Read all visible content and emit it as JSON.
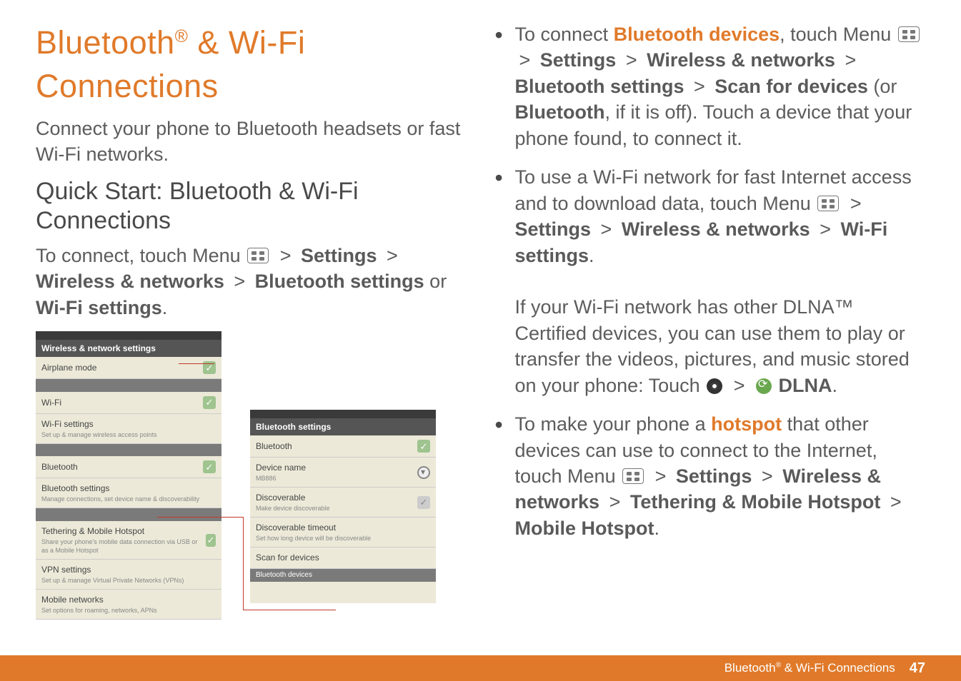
{
  "title_a": "Bluetooth",
  "title_b": " & Wi-Fi Connections",
  "intro": "Connect your phone to Bluetooth headsets or fast Wi-Fi networks.",
  "subtitle": "Quick Start: Bluetooth & Wi-Fi Connections",
  "left_line1_a": "To connect, touch Menu ",
  "left_line1_b": " > ",
  "left_settings": "Settings",
  "left_line2_a": "Wireless & networks",
  "left_line2_b": " > ",
  "left_line2_c": "Bluetooth settings",
  "left_or": " or ",
  "left_wifi": "Wi-Fi settings",
  "left_dot": ".",
  "mock1": {
    "title": "Wireless & network settings",
    "items": [
      {
        "n": "Airplane mode",
        "d": "",
        "chk": true,
        "topbox": true
      },
      {
        "n": "Wi-Fi",
        "d": "",
        "chk": true
      },
      {
        "n": "Wi-Fi settings",
        "d": "Set up & manage wireless access points",
        "arrow": false
      },
      {
        "n": "Bluetooth",
        "d": "",
        "chk": true
      },
      {
        "n": "Bluetooth settings",
        "d": "Manage connections, set device name & discoverability",
        "arrow": false
      },
      {
        "n": "Tethering & Mobile Hotspot",
        "d": "Share your phone's mobile data connection via USB or as a Mobile Hotspot",
        "chk": true
      },
      {
        "n": "VPN settings",
        "d": "Set up & manage Virtual Private Networks (VPNs)"
      },
      {
        "n": "Mobile networks",
        "d": "Set options for roaming, networks, APNs"
      }
    ]
  },
  "mock2": {
    "title": "Bluetooth settings",
    "items": [
      {
        "n": "Bluetooth",
        "d": "",
        "chk": true
      },
      {
        "n": "Device name",
        "d": "MB886",
        "radio": true
      },
      {
        "n": "Discoverable",
        "d": "Make device discoverable",
        "chkgrey": true
      },
      {
        "n": "Discoverable timeout",
        "d": "Set how long device will be discoverable"
      },
      {
        "n": "Scan for devices",
        "d": ""
      }
    ],
    "sub": "Bluetooth devices"
  },
  "r1_a": "To connect ",
  "r1_b": "Bluetooth devices",
  "r1_c": ", touch Menu ",
  "r2_gt1": " > ",
  "r2_settings": "Settings",
  "r2_gt2": " > ",
  "r2_wnlabel": "Wireless & networks",
  "r2_gt3": " > ",
  "r2_bt": "Bluetooth settings",
  "r2_gt4": " > ",
  "r2_scan": "Scan for devices",
  "r2_or": " (or ",
  "r2_bton": "Bluetooth",
  "r2_tail": ", if it is off). Touch a device that your phone found, to connect it.",
  "r3_a": "To use a Wi-Fi network for fast Internet access and to download data, touch Menu ",
  "r3_gt1": " > ",
  "r3_settings": "Settings",
  "r3_gt2": " > ",
  "r3_wn": "Wireless & networks",
  "r3_gt3": " > ",
  "r3_wifi": "Wi-Fi settings",
  "r3_dot": ".",
  "r3_b": "If your Wi-Fi network has other DLNA™ Certified devices, you can use them to play or transfer the videos, pictures, and music stored on your phone: Touch ",
  "r3_dlna": " DLNA",
  "r3_dot2": ".",
  "r4_a": "To make your phone a ",
  "r4_b": "hotspot",
  "r4_c": " that other devices can use to connect to the Internet, touch Menu ",
  "r4_gt1": " > ",
  "r4_settings": "Settings",
  "r4_gt2": " > ",
  "r4_wn": "Wireless & networks",
  "r4_gt3": " > ",
  "r4_teth": "Tethering & Mobile Hotspot",
  "r4_gt4": " > ",
  "r4_mhs": "Mobile Hotspot",
  "r4_dot": ".",
  "footer_a": "Bluetooth",
  "footer_b": " & Wi-Fi Connections",
  "page_num": "47"
}
